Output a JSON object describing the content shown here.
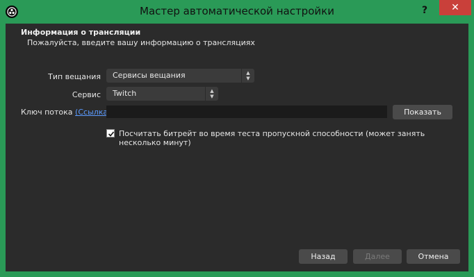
{
  "window": {
    "title": "Мастер автоматической настройки",
    "help_label": "?",
    "close_label": "✕",
    "app_icon": "obs-logo-icon"
  },
  "section": {
    "title": "Информация о трансляции",
    "subtitle": "Пожалуйста, введите вашу информацию о трансляциях"
  },
  "form": {
    "stream_type_label": "Тип вещания",
    "stream_type_value": "Сервисы вещания",
    "service_label": "Сервис",
    "service_value": "Twitch",
    "stream_key_label": "Ключ потока",
    "stream_key_link": "(Ссылка)",
    "stream_key_value": "",
    "show_button": "Показать",
    "bitrate_checkbox_label": "Посчитать битрейт во время теста пропускной способности (может занять несколько минут)",
    "bitrate_checked": true
  },
  "footer": {
    "back": "Назад",
    "next": "Далее",
    "cancel": "Отмена"
  },
  "colors": {
    "titlebar": "#2a9a57",
    "content_bg": "#2b2b2b",
    "link": "#5b9bff",
    "close": "#c9403a"
  }
}
